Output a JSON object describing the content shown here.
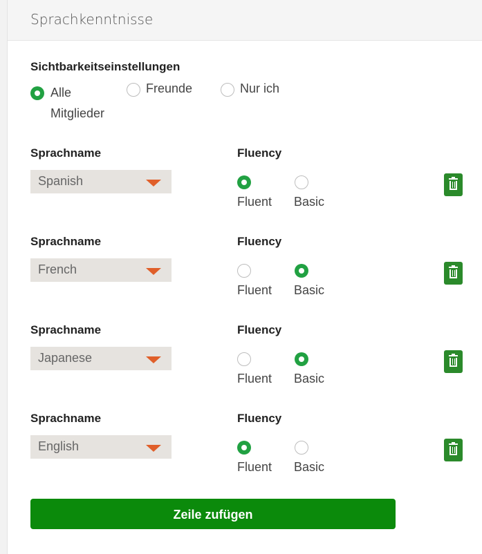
{
  "section": {
    "title": "Sprachkenntnisse"
  },
  "visibility": {
    "heading": "Sichtbarkeitseinstellungen",
    "options": [
      {
        "label_line1": "Alle",
        "label_line2": "Mitglieder",
        "selected": true
      },
      {
        "label": "Freunde",
        "selected": false
      },
      {
        "label": "Nur ich",
        "selected": false
      }
    ]
  },
  "languages": [
    {
      "name_label": "Sprachname",
      "fluency_label": "Fluency",
      "value": "Spanish",
      "fluent_label": "Fluent",
      "basic_label": "Basic",
      "fluency": "Fluent"
    },
    {
      "name_label": "Sprachname",
      "fluency_label": "Fluency",
      "value": "French",
      "fluent_label": "Fluent",
      "basic_label": "Basic",
      "fluency": "Basic"
    },
    {
      "name_label": "Sprachname",
      "fluency_label": "Fluency",
      "value": "Japanese",
      "fluent_label": "Fluent",
      "basic_label": "Basic",
      "fluency": "Basic"
    },
    {
      "name_label": "Sprachname",
      "fluency_label": "Fluency",
      "value": "English",
      "fluent_label": "Fluent",
      "basic_label": "Basic",
      "fluency": "Fluent"
    }
  ],
  "icons": {
    "dropdown": "caret-down-icon",
    "delete": "trash-icon"
  },
  "colors": {
    "accent_green": "#21a142",
    "button_green": "#0b8a0b",
    "caret_orange": "#e05f2a"
  },
  "add_button": {
    "label": "Zeile zufügen"
  }
}
